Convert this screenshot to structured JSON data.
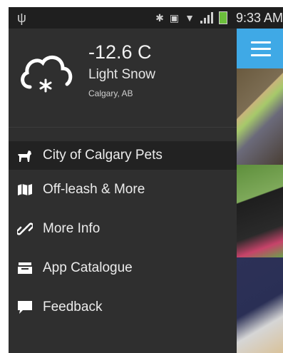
{
  "status_bar": {
    "time": "9:33 AM",
    "icons": [
      "usb-icon",
      "bluetooth-icon",
      "nfc-icon",
      "wifi-icon",
      "signal-icon",
      "battery-icon"
    ]
  },
  "weather": {
    "temperature": "-12.6 C",
    "condition": "Light Snow",
    "location": "Calgary, AB",
    "icon": "cloud-snow-icon"
  },
  "drawer": {
    "items": [
      {
        "label": "City of Calgary Pets",
        "icon": "dog-icon",
        "active": true
      },
      {
        "label": "Off-leash & More",
        "icon": "map-icon",
        "active": false
      },
      {
        "label": "More Info",
        "icon": "link-icon",
        "active": false
      },
      {
        "label": "App Catalogue",
        "icon": "inbox-icon",
        "active": false
      },
      {
        "label": "Feedback",
        "icon": "chat-bubble-icon",
        "active": false
      }
    ]
  },
  "app_bar": {
    "color": "#3fa9e6",
    "menu_icon": "hamburger-icon"
  }
}
